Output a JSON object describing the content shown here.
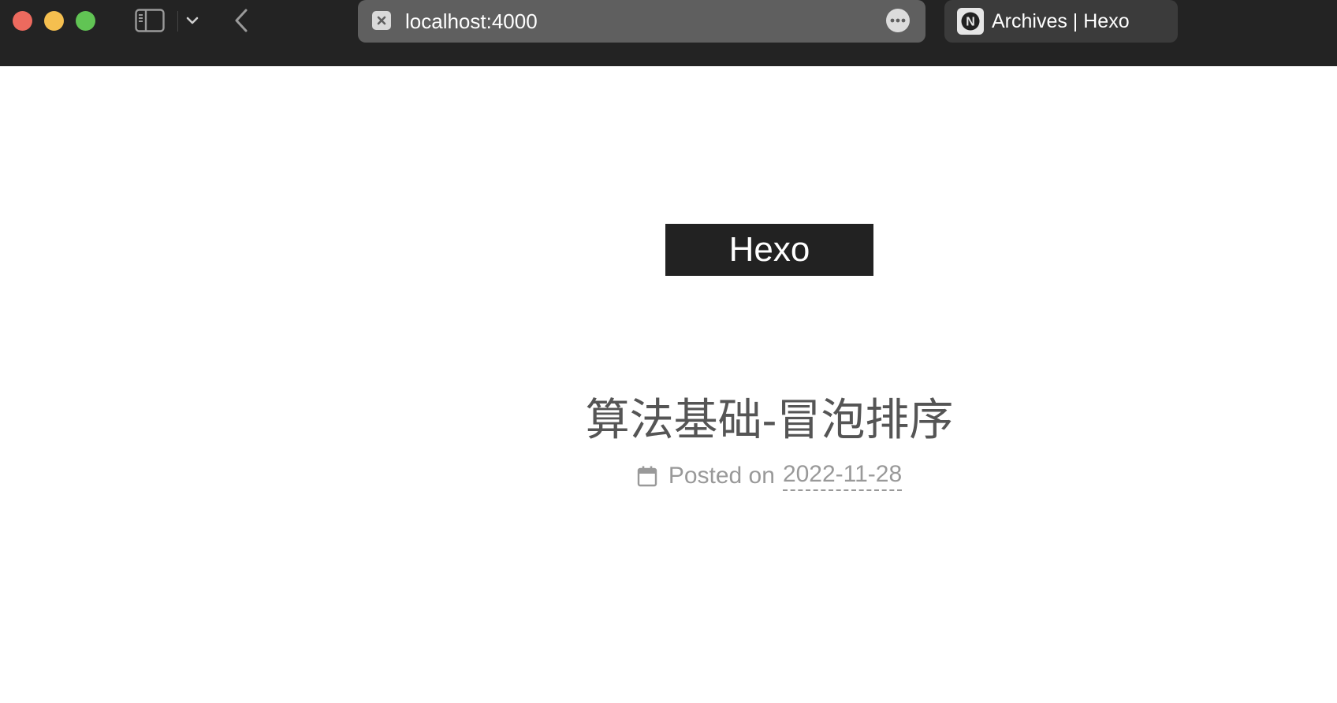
{
  "browser": {
    "url": "localhost:4000",
    "tab_title": "Archives | Hexo",
    "tab_favicon_letter": "N",
    "colors": {
      "titlebar": "#232323",
      "url_bar": "#5f5f5f",
      "close": "#ed6a5e",
      "minimize": "#f5bf4f",
      "maximize": "#61c454"
    }
  },
  "page": {
    "brand": "Hexo",
    "post": {
      "title": "算法基础-冒泡排序",
      "posted_label": "Posted on",
      "date": "2022-11-28"
    }
  }
}
